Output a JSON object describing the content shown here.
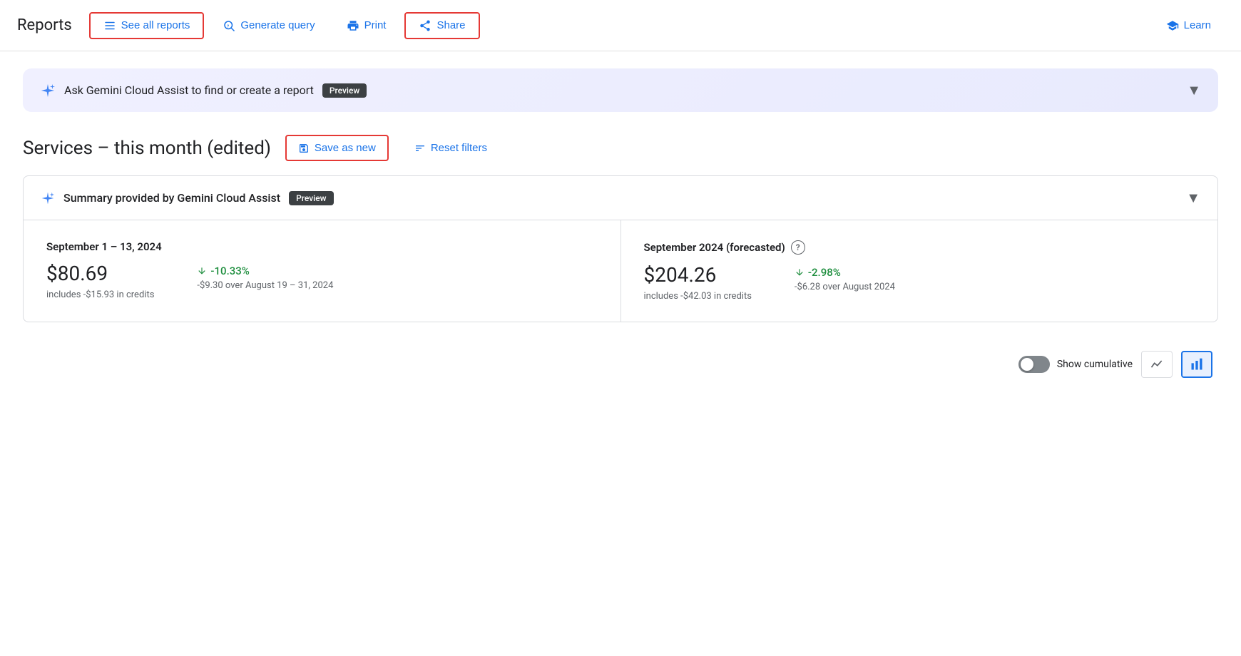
{
  "header": {
    "title": "Reports",
    "see_all_reports": "See all reports",
    "generate_query": "Generate query",
    "print": "Print",
    "share": "Share",
    "learn": "Learn"
  },
  "gemini_banner": {
    "text": "Ask Gemini Cloud Assist to find or create a report",
    "badge": "Preview"
  },
  "report": {
    "title": "Services – this month (edited)",
    "save_as_new": "Save as new",
    "reset_filters": "Reset filters"
  },
  "summary_card": {
    "header": "Summary provided by Gemini Cloud Assist",
    "badge": "Preview",
    "col1": {
      "period": "September 1 – 13, 2024",
      "amount": "$80.69",
      "credits": "includes -$15.93 in credits",
      "change": "-10.33%",
      "change_detail": "-$9.30 over August 19 – 31, 2024"
    },
    "col2": {
      "period": "September 2024 (forecasted)",
      "amount": "$204.26",
      "credits": "includes -$42.03 in credits",
      "change": "-2.98%",
      "change_detail": "-$6.28 over August 2024"
    }
  },
  "bottom_toolbar": {
    "show_cumulative": "Show cumulative"
  },
  "icons": {
    "list": "☰",
    "search": "🔍",
    "print": "🖨",
    "share": "🔗",
    "learn": "🎓",
    "gemini": "✦",
    "save": "💾",
    "filter": "≡",
    "chevron_down": "▼",
    "arrow_down_green": "↓",
    "line_chart": "∿",
    "bar_chart": "▊"
  }
}
